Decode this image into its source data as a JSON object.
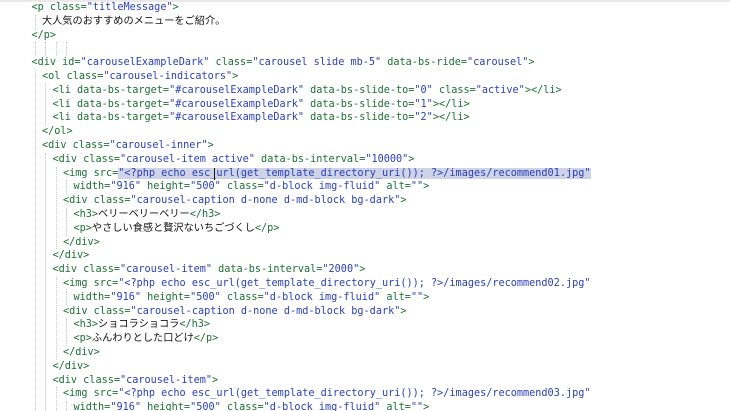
{
  "editor": {
    "lines": [
      {
        "indent": 3,
        "tokens": [
          {
            "t": "<p ",
            "c": "tag"
          },
          {
            "t": "class=",
            "c": "attr"
          },
          {
            "t": "\"titleMessage\"",
            "c": "str"
          },
          {
            "t": ">",
            "c": "tag"
          }
        ]
      },
      {
        "indent": 4,
        "tokens": [
          {
            "t": "大人気のおすすめのメニューをご紹介。",
            "c": "text"
          }
        ]
      },
      {
        "indent": 3,
        "tokens": [
          {
            "t": "</p>",
            "c": "tag"
          }
        ]
      },
      {
        "indent": 0,
        "tokens": []
      },
      {
        "indent": 3,
        "tokens": [
          {
            "t": "<div ",
            "c": "tag"
          },
          {
            "t": "id=",
            "c": "attr"
          },
          {
            "t": "\"carouselExampleDark\"",
            "c": "str"
          },
          {
            "t": " class=",
            "c": "attr"
          },
          {
            "t": "\"carousel slide mb-5\"",
            "c": "str"
          },
          {
            "t": " data-bs-ride=",
            "c": "attr"
          },
          {
            "t": "\"carousel\"",
            "c": "str"
          },
          {
            "t": ">",
            "c": "tag"
          }
        ]
      },
      {
        "indent": 4,
        "tokens": [
          {
            "t": "<ol ",
            "c": "tag"
          },
          {
            "t": "class=",
            "c": "attr"
          },
          {
            "t": "\"carousel-indicators\"",
            "c": "str"
          },
          {
            "t": ">",
            "c": "tag"
          }
        ]
      },
      {
        "indent": 5,
        "tokens": [
          {
            "t": "<li ",
            "c": "tag"
          },
          {
            "t": "data-bs-target=",
            "c": "attr"
          },
          {
            "t": "\"#carouselExampleDark\"",
            "c": "str"
          },
          {
            "t": " data-bs-slide-to=",
            "c": "attr"
          },
          {
            "t": "\"0\"",
            "c": "str"
          },
          {
            "t": " class=",
            "c": "attr"
          },
          {
            "t": "\"active\"",
            "c": "str"
          },
          {
            "t": "></li>",
            "c": "tag"
          }
        ]
      },
      {
        "indent": 5,
        "tokens": [
          {
            "t": "<li ",
            "c": "tag"
          },
          {
            "t": "data-bs-target=",
            "c": "attr"
          },
          {
            "t": "\"#carouselExampleDark\"",
            "c": "str"
          },
          {
            "t": " data-bs-slide-to=",
            "c": "attr"
          },
          {
            "t": "\"1\"",
            "c": "str"
          },
          {
            "t": "></li>",
            "c": "tag"
          }
        ]
      },
      {
        "indent": 5,
        "tokens": [
          {
            "t": "<li ",
            "c": "tag"
          },
          {
            "t": "data-bs-target=",
            "c": "attr"
          },
          {
            "t": "\"#carouselExampleDark\"",
            "c": "str"
          },
          {
            "t": " data-bs-slide-to=",
            "c": "attr"
          },
          {
            "t": "\"2\"",
            "c": "str"
          },
          {
            "t": "></li>",
            "c": "tag"
          }
        ]
      },
      {
        "indent": 4,
        "tokens": [
          {
            "t": "</ol>",
            "c": "tag"
          }
        ]
      },
      {
        "indent": 4,
        "tokens": [
          {
            "t": "<div ",
            "c": "tag"
          },
          {
            "t": "class=",
            "c": "attr"
          },
          {
            "t": "\"carousel-inner\"",
            "c": "str"
          },
          {
            "t": ">",
            "c": "tag"
          }
        ]
      },
      {
        "indent": 5,
        "tokens": [
          {
            "t": "<div ",
            "c": "tag"
          },
          {
            "t": "class=",
            "c": "attr"
          },
          {
            "t": "\"carousel-item active\"",
            "c": "str"
          },
          {
            "t": " data-bs-interval=",
            "c": "attr"
          },
          {
            "t": "\"10000\"",
            "c": "str"
          },
          {
            "t": ">",
            "c": "tag"
          }
        ]
      },
      {
        "indent": 6,
        "tokens": [
          {
            "t": "<img ",
            "c": "tag"
          },
          {
            "t": "src=",
            "c": "attr"
          },
          {
            "t": "\"<?php echo esc_url(get_template_directory_uri()); ?>/images/recommend01.jpg\"",
            "c": "str",
            "sel": true
          }
        ]
      },
      {
        "indent": 7,
        "tokens": [
          {
            "t": "width=",
            "c": "attr"
          },
          {
            "t": "\"916\"",
            "c": "str"
          },
          {
            "t": " height=",
            "c": "attr"
          },
          {
            "t": "\"500\"",
            "c": "str"
          },
          {
            "t": " class=",
            "c": "attr"
          },
          {
            "t": "\"d-block img-fluid\"",
            "c": "str"
          },
          {
            "t": " alt=",
            "c": "attr"
          },
          {
            "t": "\"\"",
            "c": "str"
          },
          {
            "t": ">",
            "c": "tag"
          }
        ]
      },
      {
        "indent": 6,
        "tokens": [
          {
            "t": "<div ",
            "c": "tag"
          },
          {
            "t": "class=",
            "c": "attr"
          },
          {
            "t": "\"carousel-caption d-none d-md-block bg-dark\"",
            "c": "str"
          },
          {
            "t": ">",
            "c": "tag"
          }
        ]
      },
      {
        "indent": 7,
        "tokens": [
          {
            "t": "<h3>",
            "c": "tag"
          },
          {
            "t": "ベリーベリーベリー",
            "c": "text"
          },
          {
            "t": "</h3>",
            "c": "tag"
          }
        ]
      },
      {
        "indent": 7,
        "tokens": [
          {
            "t": "<p>",
            "c": "tag"
          },
          {
            "t": "やさしい食感と贅沢ないちごづくし",
            "c": "text"
          },
          {
            "t": "</p>",
            "c": "tag"
          }
        ]
      },
      {
        "indent": 6,
        "tokens": [
          {
            "t": "</div>",
            "c": "tag"
          }
        ]
      },
      {
        "indent": 5,
        "tokens": [
          {
            "t": "</div>",
            "c": "tag"
          }
        ]
      },
      {
        "indent": 5,
        "tokens": [
          {
            "t": "<div ",
            "c": "tag"
          },
          {
            "t": "class=",
            "c": "attr"
          },
          {
            "t": "\"carousel-item\"",
            "c": "str"
          },
          {
            "t": " data-bs-interval=",
            "c": "attr"
          },
          {
            "t": "\"2000\"",
            "c": "str"
          },
          {
            "t": ">",
            "c": "tag"
          }
        ]
      },
      {
        "indent": 6,
        "tokens": [
          {
            "t": "<img ",
            "c": "tag"
          },
          {
            "t": "src=",
            "c": "attr"
          },
          {
            "t": "\"<?php echo esc_url(get_template_directory_uri()); ?>/images/recommend02.jpg\"",
            "c": "str"
          }
        ]
      },
      {
        "indent": 7,
        "tokens": [
          {
            "t": "width=",
            "c": "attr"
          },
          {
            "t": "\"916\"",
            "c": "str"
          },
          {
            "t": " height=",
            "c": "attr"
          },
          {
            "t": "\"500\"",
            "c": "str"
          },
          {
            "t": " class=",
            "c": "attr"
          },
          {
            "t": "\"d-block img-fluid\"",
            "c": "str"
          },
          {
            "t": " alt=",
            "c": "attr"
          },
          {
            "t": "\"\"",
            "c": "str"
          },
          {
            "t": ">",
            "c": "tag"
          }
        ]
      },
      {
        "indent": 6,
        "tokens": [
          {
            "t": "<div ",
            "c": "tag"
          },
          {
            "t": "class=",
            "c": "attr"
          },
          {
            "t": "\"carousel-caption d-none d-md-block bg-dark\"",
            "c": "str"
          },
          {
            "t": ">",
            "c": "tag"
          }
        ]
      },
      {
        "indent": 7,
        "tokens": [
          {
            "t": "<h3>",
            "c": "tag"
          },
          {
            "t": "ショコラショコラ",
            "c": "text"
          },
          {
            "t": "</h3>",
            "c": "tag"
          }
        ]
      },
      {
        "indent": 7,
        "tokens": [
          {
            "t": "<p>",
            "c": "tag"
          },
          {
            "t": "ふんわりとした口どけ",
            "c": "text"
          },
          {
            "t": "</p>",
            "c": "tag"
          }
        ]
      },
      {
        "indent": 6,
        "tokens": [
          {
            "t": "</div>",
            "c": "tag"
          }
        ]
      },
      {
        "indent": 5,
        "tokens": [
          {
            "t": "</div>",
            "c": "tag"
          }
        ]
      },
      {
        "indent": 5,
        "tokens": [
          {
            "t": "<div ",
            "c": "tag"
          },
          {
            "t": "class=",
            "c": "attr"
          },
          {
            "t": "\"carousel-item\"",
            "c": "str"
          },
          {
            "t": ">",
            "c": "tag"
          }
        ]
      },
      {
        "indent": 6,
        "tokens": [
          {
            "t": "<img ",
            "c": "tag"
          },
          {
            "t": "src=",
            "c": "attr"
          },
          {
            "t": "\"<?php echo esc_url(get_template_directory_uri()); ?>/images/recommend03.jpg\"",
            "c": "str"
          }
        ]
      },
      {
        "indent": 7,
        "tokens": [
          {
            "t": "width=",
            "c": "attr"
          },
          {
            "t": "\"916\"",
            "c": "str"
          },
          {
            "t": " height=",
            "c": "attr"
          },
          {
            "t": "\"500\"",
            "c": "str"
          },
          {
            "t": " class=",
            "c": "attr"
          },
          {
            "t": "\"d-block img-fluid\"",
            "c": "str"
          },
          {
            "t": " alt=",
            "c": "attr"
          },
          {
            "t": "\"\"",
            "c": "str"
          },
          {
            "t": ">",
            "c": "tag"
          }
        ]
      }
    ],
    "colors": {
      "tag": "#1d6f35",
      "attr": "#1d6f35",
      "string": "#2a3fb8",
      "text": "#111111",
      "selection": "#cfd3e8",
      "background": "#ffffff"
    }
  }
}
